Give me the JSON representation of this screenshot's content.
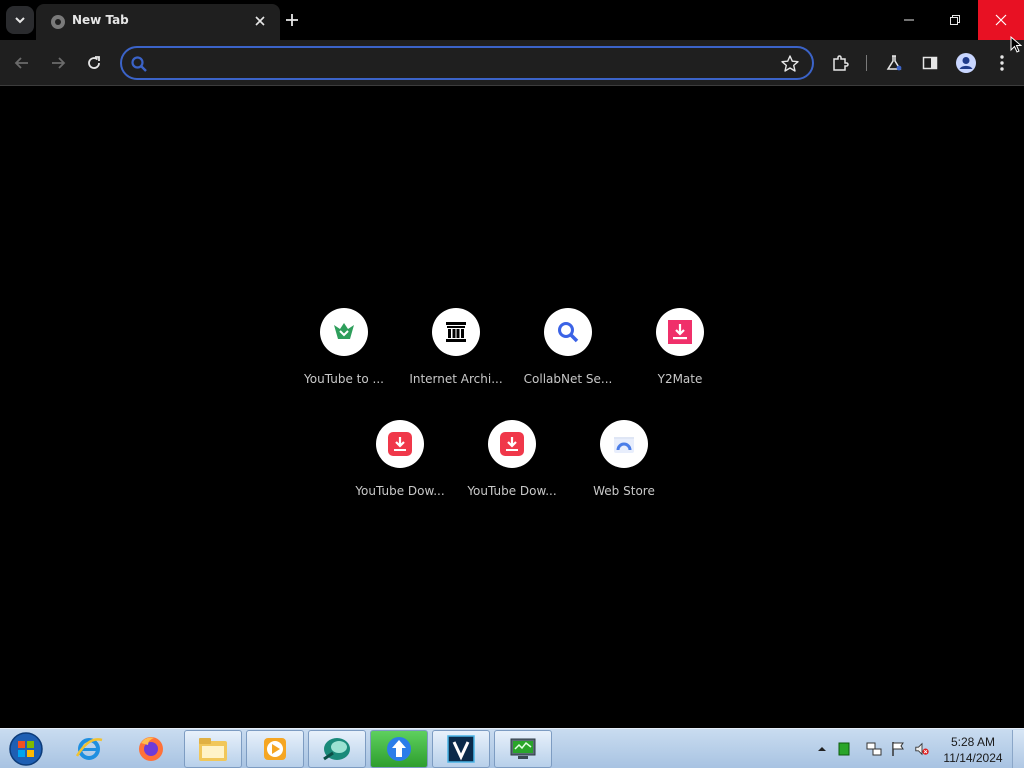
{
  "browser": {
    "tab": {
      "title": "New Tab"
    },
    "omnibox": {
      "value": "",
      "placeholder": ""
    }
  },
  "shortcuts": [
    {
      "label": "YouTube to ...",
      "icon": "youtube-to-icon",
      "color": "#2e9e5b"
    },
    {
      "label": "Internet Archi...",
      "icon": "internet-archive-icon",
      "color": "#000000"
    },
    {
      "label": "CollabNet Se...",
      "icon": "collabnet-search-icon",
      "color": "#3b63e6"
    },
    {
      "label": "Y2Mate",
      "icon": "y2mate-icon",
      "color": "#f0306a"
    },
    {
      "label": "YouTube Dow...",
      "icon": "youtube-downloader-icon",
      "color": "#f0384a"
    },
    {
      "label": "YouTube Dow...",
      "icon": "youtube-downloader-icon",
      "color": "#f0384a"
    },
    {
      "label": "Web Store",
      "icon": "web-store-icon",
      "color": "#4a7de8"
    }
  ],
  "taskbar": {
    "apps": [
      "internet-explorer-icon",
      "firefox-icon",
      "file-explorer-icon",
      "media-player-icon",
      "app-icon",
      "uploader-icon",
      "v-app-icon",
      "monitor-app-icon"
    ],
    "clock": {
      "time": "5:28 AM",
      "date": "11/14/2024"
    }
  },
  "colors": {
    "accent": "#3b63c8",
    "close_hover": "#e81123",
    "toolbar_bg": "#1f1f1f"
  }
}
